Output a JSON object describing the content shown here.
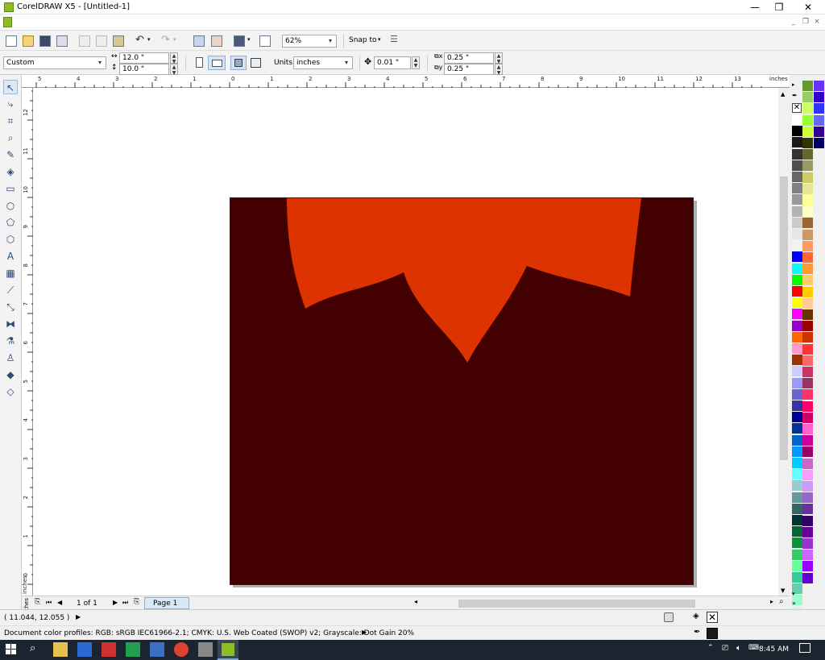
{
  "window": {
    "title": "CorelDRAW X5 - [Untitled-1]",
    "minimize": "—",
    "maximize": "❐",
    "close": "✕"
  },
  "mdi": {
    "minimize": "_",
    "restore": "❐",
    "close": "×"
  },
  "toolbar": {
    "zoom": "62%",
    "snap_to": "Snap to"
  },
  "property_bar": {
    "page_preset": "Custom",
    "width": "12.0 \"",
    "height": "10.0 \"",
    "units_label": "Units:",
    "units_value": "inches",
    "nudge": "0.01 \"",
    "dup_x": "0.25 \"",
    "dup_y": "0.25 \""
  },
  "rulers": {
    "top_labels": [
      "5",
      "4",
      "3",
      "2",
      "1",
      "0",
      "1",
      "2",
      "3",
      "4",
      "5",
      "6",
      "7",
      "8",
      "9",
      "10",
      "11",
      "12",
      "13"
    ],
    "top_unit": "inches",
    "left_labels": [
      "12",
      "11",
      "10",
      "9",
      "8",
      "7",
      "6",
      "5",
      "4",
      "3",
      "2",
      "1",
      "0"
    ],
    "left_unit": "inches"
  },
  "canvas": {
    "page_color": "#420000",
    "shape_color": "#dd3300"
  },
  "page_nav": {
    "counter": "1 of 1",
    "page_tab": "Page 1"
  },
  "status": {
    "coordinates": "( 11.044, 12.055 )",
    "color_profiles": "Document color profiles: RGB: sRGB IEC61966-2.1; CMYK: U.S. Web Coated (SWOP) v2; Grayscale: Dot Gain 20%"
  },
  "taskbar": {
    "time": "8:45 AM"
  },
  "palette": {
    "col1": [
      "#ffffff",
      "#000000",
      "#1a1a1a",
      "#333333",
      "#4d4d4d",
      "#666666",
      "#808080",
      "#999999",
      "#b3b3b3",
      "#cccccc",
      "#e6e6e6",
      "#f2f2f2",
      "#0000ff",
      "#00ffff",
      "#00ff00",
      "#ff0000",
      "#ffff00",
      "#ff00ff",
      "#9900cc",
      "#ff6600",
      "#ff99cc",
      "#993300",
      "#ccccff",
      "#9999ff",
      "#6666cc",
      "#3333aa",
      "#000099",
      "#003399",
      "#0066cc",
      "#0099ff",
      "#00ccff",
      "#66ffff",
      "#99cccc",
      "#669999",
      "#336666",
      "#003333",
      "#006633",
      "#009933",
      "#33cc66",
      "#66ff99",
      "#33cc99",
      "#66ccaa",
      "#99ffcc",
      "#ccffcc"
    ],
    "col2": [
      "#669933",
      "#99cc66",
      "#ccff66",
      "#99ff33",
      "#ccff33",
      "#333300",
      "#666633",
      "#999966",
      "#cccc66",
      "#e6e699",
      "#ffff99",
      "#ffffcc",
      "#996633",
      "#cc9966",
      "#ff9966",
      "#ff6633",
      "#ff9933",
      "#ffcc66",
      "#ffcc00",
      "#ffcc99",
      "#663300",
      "#990000",
      "#cc3300",
      "#ff3333",
      "#ff6666",
      "#cc3366",
      "#993366",
      "#ff3366",
      "#ff0066",
      "#cc0066",
      "#ff66cc",
      "#cc0099",
      "#990066",
      "#cc66cc",
      "#ff99ff",
      "#cc99ff",
      "#9966cc",
      "#663399",
      "#330066",
      "#660099",
      "#9933cc",
      "#cc66ff",
      "#9900ff",
      "#6600cc"
    ],
    "col3": [
      "#6633ff",
      "#3300cc",
      "#3333ff",
      "#6666ff",
      "#330099",
      "#000066"
    ]
  }
}
